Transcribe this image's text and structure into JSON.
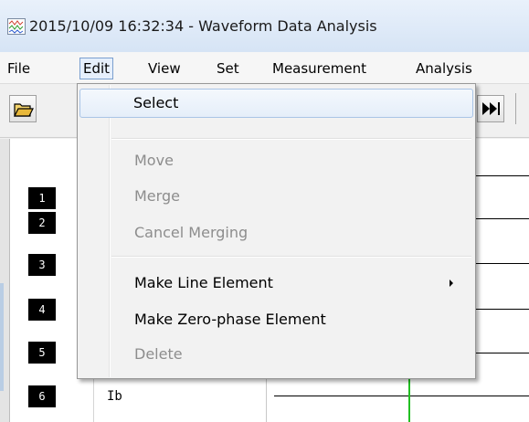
{
  "window": {
    "title": "2015/10/09 16:32:34  - Waveform Data Analysis"
  },
  "menubar": {
    "items": [
      "File",
      "Edit",
      "View",
      "Set",
      "Measurement",
      "Analysis"
    ]
  },
  "edit_menu": {
    "items": [
      {
        "label": "Select",
        "enabled": true,
        "highlighted": true
      },
      {
        "label": "Move",
        "enabled": false
      },
      {
        "label": "Merge",
        "enabled": false
      },
      {
        "label": "Cancel Merging",
        "enabled": false
      },
      {
        "label": "Make Line Element",
        "enabled": true,
        "has_submenu": true
      },
      {
        "label": "Make Zero-phase Element",
        "enabled": true
      },
      {
        "label": "Delete",
        "enabled": false
      }
    ]
  },
  "channels": {
    "numbers": [
      "1",
      "2",
      "3",
      "4",
      "5",
      "6"
    ],
    "visible_names": {
      "6": "Ib"
    }
  },
  "toolbar": {
    "icons": [
      "open-folder-icon",
      "fast-forward-icon"
    ]
  },
  "colors": {
    "cursor": "#22c022",
    "menu_highlight_border": "#a9c4e6",
    "disabled_text": "#8d8d8d"
  }
}
